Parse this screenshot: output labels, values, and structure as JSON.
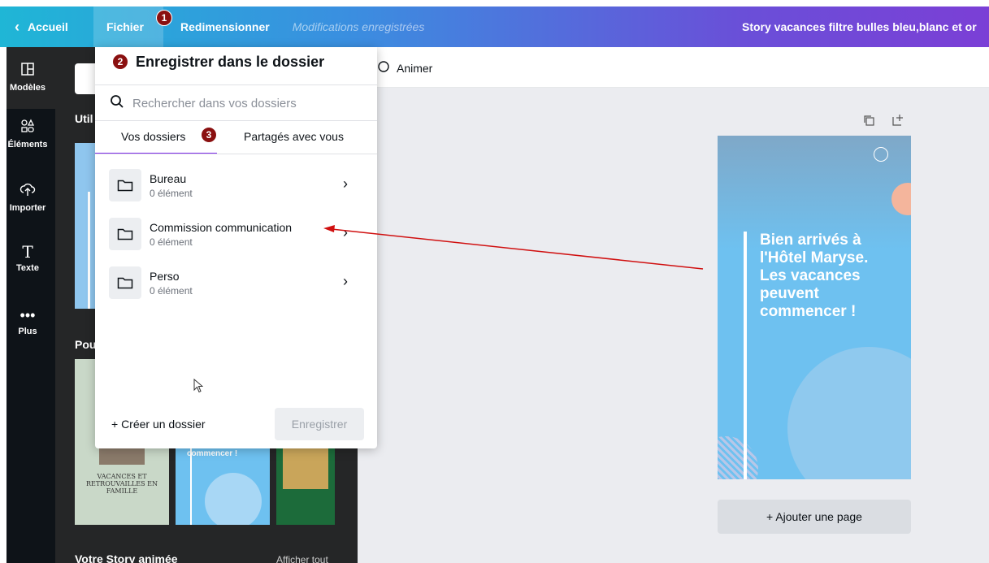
{
  "topbar": {
    "back_label": "Accueil",
    "file_label": "Fichier",
    "resize_label": "Redimensionner",
    "status": "Modifications enregistrées",
    "doc_title": "Story vacances filtre bulles bleu,blanc et or"
  },
  "badges": [
    "1",
    "2",
    "3"
  ],
  "rail": {
    "items": [
      {
        "label": "Modèles",
        "icon": "layout-icon"
      },
      {
        "label": "Éléments",
        "icon": "shapes-icon"
      },
      {
        "label": "Importer",
        "icon": "upload-cloud-icon"
      },
      {
        "label": "Texte",
        "icon": "text-icon"
      },
      {
        "label": "Plus",
        "icon": "more-icon"
      }
    ]
  },
  "panel": {
    "heading_1": "Util",
    "heading_2": "Pou",
    "heading_3": "Votre Story animée",
    "see_all": "Afficher tout",
    "thumb_text_a": "VACANCES ET RETROUVAILLES EN FAMILLE",
    "thumb_text_b": "peuvent commencer !"
  },
  "toolbar": {
    "animate_label": "Animer"
  },
  "dialog": {
    "title": "Enregistrer dans le dossier",
    "search_placeholder": "Rechercher dans vos dossiers",
    "tabs": [
      "Vos dossiers",
      "Partagés avec vous"
    ],
    "folders": [
      {
        "name": "Bureau",
        "count": "0 élément"
      },
      {
        "name": "Commission communication",
        "count": "0 élément"
      },
      {
        "name": "Perso",
        "count": "0 élément"
      }
    ],
    "create_label": "+ Créer un dossier",
    "save_label": "Enregistrer"
  },
  "story": {
    "text": "Bien arrivés à l'Hôtel Maryse. Les vacances peuvent commencer !"
  },
  "add_page_label": "+ Ajouter une page",
  "colors": {
    "accent": "#7d2ae8",
    "badge": "#8a1010",
    "story_bg": "#6ec1f0",
    "arrow": "#d01010"
  }
}
